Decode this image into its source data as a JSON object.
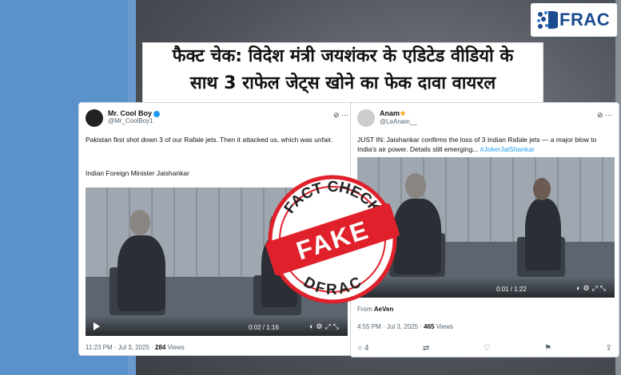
{
  "brand": {
    "logo_text": "FRAC"
  },
  "headline": {
    "line1": "फैक्ट चेक: विदेश मंत्री जयशंकर के एडिटेड वीडियो के",
    "line2": "साथ 3 राफेल जेट्स खोने का फेक दावा वायरल"
  },
  "tweet1": {
    "display_name": "Mr. Cool Boy",
    "handle": "@Mr_CoolBoy1",
    "text1": "Pakistan first shot down 3 of our Rafale jets. Then it attacked us, which was unfair.",
    "text2": "Indian Foreign Minister Jaishankar",
    "video_time": "0:02 / 1:16",
    "timestamp": "11:23 PM · Jul 3, 2025 · ",
    "views_count": "284",
    "views_label": " Views"
  },
  "tweet2": {
    "display_name": "Anam",
    "handle": "@LeAnam__",
    "text1": "JUST IN: Jaishankar confirms the loss of 3 Indian Rafale jets — a major blow to India's air power. Details still emerging...",
    "hashtag": "#JokerJaiShankar",
    "video_time": "0:01 / 1:22",
    "from_label": "From ",
    "from_name": "AeVen",
    "timestamp": "4:55 PM · Jul 3, 2025 · ",
    "views_count": "465",
    "views_label": " Views",
    "replies": "4"
  },
  "stamp": {
    "top_text": "FACT CHECK",
    "center_text": "FAKE",
    "bottom_text": "DFRAC",
    "color": "#e0212b"
  }
}
